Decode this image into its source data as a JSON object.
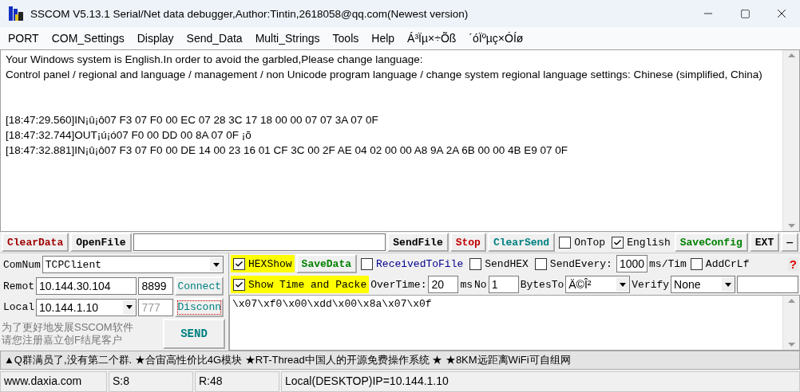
{
  "window": {
    "title": "SSCOM V5.13.1 Serial/Net data debugger,Author:Tintin,2618058@qq.com(Newest version)"
  },
  "menu": [
    "PORT",
    "COM_Settings",
    "Display",
    "Send_Data",
    "Multi_Strings",
    "Tools",
    "Help",
    "Á³Ïµ×÷Õß",
    "´óÏºµç×ÓÍø"
  ],
  "receive": {
    "notice_lines": [
      "Your Windows system is English.In order to avoid the garbled,Please change language:",
      "Control panel / regional and language / management / non Unicode program language / change system regional language settings: Chinese (simplified, China)"
    ],
    "log_lines": [
      "[18:47:29.560]IN¡û¡ô07 F3 07 F0 00 EC 07 28 3C 17 18 00 00 07 07 3A 07 0F",
      "[18:47:32.744]OUT¡ú¡ó07 F0 00 DD 00 8A 07 0F ¡õ",
      "[18:47:32.881]IN¡û¡ô07 F3 07 F0 00 DE 14 00 23 16 01 CF 3C 00 2F AE 04 02 00 00 A8 9A 2A 6B 00 00 4B E9 07 0F"
    ]
  },
  "toolbar": [
    {
      "kind": "button",
      "label": "ClearData",
      "color": "#a00000"
    },
    {
      "kind": "button",
      "label": "OpenFile",
      "color": "#000000"
    },
    {
      "kind": "wide_field"
    },
    {
      "kind": "button",
      "label": "SendFile",
      "color": "#000000"
    },
    {
      "kind": "button",
      "label": "Stop",
      "color": "#c00000"
    },
    {
      "kind": "button",
      "label": "ClearSend",
      "color": "#008080"
    },
    {
      "kind": "checkbox",
      "label": "OnTop",
      "checked": false,
      "highlighted": false,
      "color": "#000000"
    },
    {
      "kind": "checkbox",
      "label": "English",
      "checked": true,
      "highlighted": false,
      "color": "#000000"
    },
    {
      "kind": "button",
      "label": "SaveConfig",
      "color": "#008000"
    },
    {
      "kind": "button",
      "label": "EXT",
      "color": "#000000"
    },
    {
      "kind": "button",
      "label": "—",
      "color": "#000000"
    }
  ],
  "connection": {
    "comnum_label": "ComNum",
    "comnum": "TCPClient",
    "remote_label": "Remot",
    "remote_ip": "10.144.30.104",
    "remote_port": "8899",
    "connect_button": "Connect",
    "local_label": "Local",
    "local_ip": "10.144.1.10",
    "local_port": "777",
    "disconnect_button": "Disconn",
    "notice": [
      "为了更好地发展SSCOM软件",
      "请您注册嘉立创F结尾客户"
    ],
    "send_button": "SEND"
  },
  "options_rows": [
    [
      {
        "kind": "checkbox",
        "label": "HEXShow",
        "checked": true,
        "highlighted": true,
        "color": "#000000"
      },
      {
        "kind": "button",
        "label": "SaveData",
        "color": "#008000"
      },
      {
        "kind": "checkbox",
        "label": "ReceivedToFile",
        "checked": false,
        "highlighted": false,
        "color": "#000090"
      },
      {
        "kind": "checkbox",
        "label": "SendHEX",
        "checked": false,
        "highlighted": false,
        "color": "#000000"
      },
      {
        "kind": "checkbox",
        "label": "SendEvery:",
        "checked": false,
        "highlighted": false,
        "color": "#000000"
      },
      {
        "kind": "field",
        "value": "1000"
      },
      {
        "kind": "label",
        "label": "ms/Tim"
      },
      {
        "kind": "checkbox",
        "label": "AddCrLf",
        "checked": false,
        "highlighted": false,
        "color": "#000000"
      },
      {
        "kind": "help",
        "label": "?"
      }
    ],
    [
      {
        "kind": "checkbox",
        "label": "Show Time and Packe",
        "checked": true,
        "highlighted": true,
        "color": "#000000"
      },
      {
        "kind": "label",
        "label": "OverTime:"
      },
      {
        "kind": "field",
        "value": "20"
      },
      {
        "kind": "label",
        "label": "ms"
      },
      {
        "kind": "label",
        "label": "No"
      },
      {
        "kind": "field",
        "value": "1"
      },
      {
        "kind": "label",
        "label": "BytesTo"
      },
      {
        "kind": "select",
        "value": "Ä©Î²"
      },
      {
        "kind": "label",
        "label": "Verify"
      },
      {
        "kind": "select",
        "value": "None"
      },
      {
        "kind": "wide_field"
      }
    ]
  ],
  "send_text": "\\x07\\xf0\\x00\\xdd\\x00\\x8a\\x07\\x0f",
  "ticker": "▲Q群满员了,没有第二个群. ★合宙高性价比4G模块 ★RT-Thread中国人的开源免费操作系统 ★ ★8KM远距离WiFi可自组网",
  "status_bar": [
    "www.daxia.com",
    "S:8",
    "R:48",
    "Local(DESKTOP)IP=10.144.1.10"
  ]
}
